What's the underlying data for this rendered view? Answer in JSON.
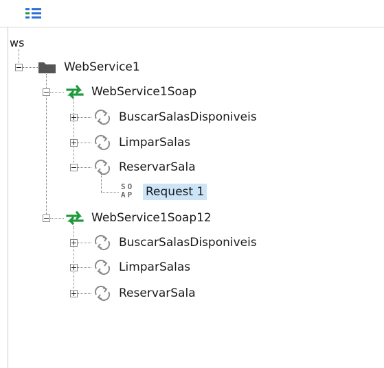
{
  "toolbar": {
    "tree_view_icon": "tree-list-icon"
  },
  "tree": {
    "root_label": "ws",
    "service": {
      "label": "WebService1",
      "icon": "folder-icon",
      "bindings": [
        {
          "label": "WebService1Soap",
          "icon": "swap-arrows-icon",
          "operations": [
            {
              "label": "BuscarSalasDisponiveis",
              "expanded": false
            },
            {
              "label": "LimparSalas",
              "expanded": false
            },
            {
              "label": "ReservarSala",
              "expanded": true,
              "requests": [
                {
                  "label": "Request 1",
                  "icon_text_top": "SO",
                  "icon_text_bottom": "AP"
                }
              ]
            }
          ]
        },
        {
          "label": "WebService1Soap12",
          "icon": "swap-arrows-icon",
          "operations": [
            {
              "label": "BuscarSalasDisponiveis",
              "expanded": false
            },
            {
              "label": "LimparSalas",
              "expanded": false
            },
            {
              "label": "ReservarSala",
              "expanded": false
            }
          ]
        }
      ]
    }
  },
  "colors": {
    "binding_arrow": "#1e9a3c",
    "operation_arrow": "#8a8a8a",
    "folder": "#555555",
    "selection": "#cce4f7",
    "toolbar_icon": "#2b6fd6"
  }
}
